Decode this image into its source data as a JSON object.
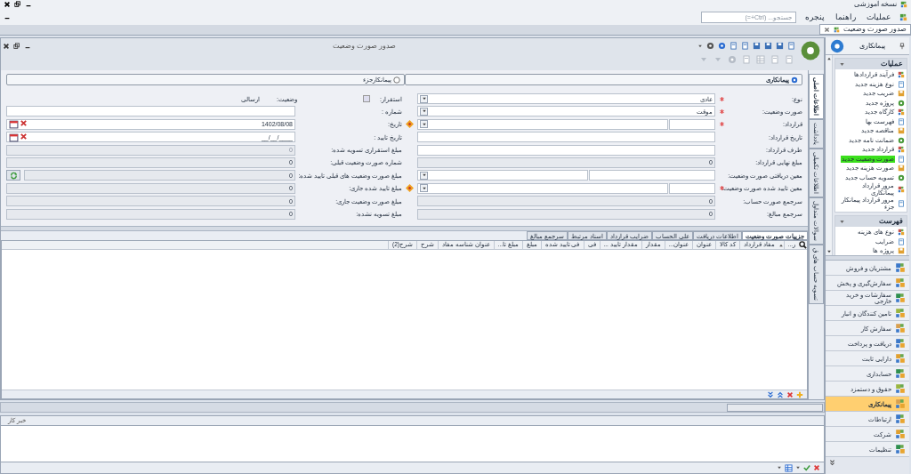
{
  "app_title": "نسخه آموزشی",
  "menu": [
    "عملیات",
    "راهنما",
    "پنجره"
  ],
  "search": {
    "placeholder": "جستجو... (Ctrl+=)"
  },
  "document_tabs": [
    {
      "label": "صدور صورت وضعیت",
      "selected": true
    }
  ],
  "window": {
    "title": "صدور صورت وضعیت"
  },
  "contractor_type": [
    {
      "label": "پیمانکاری",
      "selected": true
    },
    {
      "label": "پیمانکارجزء",
      "selected": false
    }
  ],
  "side_tabs": [
    {
      "label": "اطلاعات اصلی",
      "selected": true
    },
    {
      "label": "یادداشت",
      "selected": false
    },
    {
      "label": "اطلاعات تکمیلی",
      "selected": false
    },
    {
      "label": "سوالات متداول",
      "selected": false
    },
    {
      "label": "تسویه حساب های ق",
      "selected": false
    }
  ],
  "form_right": [
    {
      "label": "نوع:",
      "required": true,
      "kind": "select",
      "value": "عادی"
    },
    {
      "label": "صورت وضعیت:",
      "required": true,
      "kind": "select",
      "value": "موقت"
    },
    {
      "label": "قرارداد:",
      "required": true,
      "kind": "split_select"
    },
    {
      "label": "تاریخ قرارداد:",
      "required": false,
      "kind": "text"
    },
    {
      "label": "طرف قرارداد:",
      "required": false,
      "kind": "text"
    },
    {
      "label": "مبلغ نهایی قرارداد:",
      "required": false,
      "kind": "readonly",
      "value": "0"
    },
    {
      "label": "معین دریافتی صورت وضعیت:",
      "required": false,
      "kind": "split_select_wide"
    },
    {
      "label": "معین تایید شده صورت وضعیت:",
      "required": true,
      "kind": "split_select"
    },
    {
      "label": "سرجمع صورت حساب:",
      "required": false,
      "kind": "readonly",
      "value": "0"
    },
    {
      "label": "سرجمع مبالغ:",
      "required": false,
      "kind": "readonly",
      "value": "0"
    }
  ],
  "settlement": {
    "label": "استقرار:",
    "checked": false
  },
  "status": {
    "label": "وضعیت:",
    "value": "ارسالی"
  },
  "form_left": [
    {
      "label": "شماره :",
      "flag": false,
      "kind": "text"
    },
    {
      "label": "تاریخ:",
      "flag": true,
      "kind": "date",
      "value": "1402/08/08"
    },
    {
      "label": "تاریخ تایید :",
      "flag": false,
      "kind": "date",
      "value": "____/__/__"
    },
    {
      "label": "مبلغ استقراری تسویه شده:",
      "flag": false,
      "kind": "disabled",
      "value": "0"
    },
    {
      "label": "شماره صورت وضعیت قبلی:",
      "flag": false,
      "kind": "readonly",
      "value": "0"
    },
    {
      "label": "مبلغ صورت وضعیت های قبلی تایید شده:",
      "flag": false,
      "kind": "refresh",
      "value": "0"
    },
    {
      "label": "مبلغ  تایید شده جاری:",
      "flag": true,
      "kind": "readonly",
      "value": "0"
    },
    {
      "label": "مبلغ صورت وضعیت جاری:",
      "flag": false,
      "kind": "readonly",
      "value": "0"
    },
    {
      "label": "مبلغ تسویه نشده:",
      "flag": false,
      "kind": "readonly",
      "value": "0"
    }
  ],
  "grid_tabs": [
    {
      "label": "جزییات صورت وضعیت",
      "selected": true
    },
    {
      "label": "اطلاعات دریافت",
      "selected": false
    },
    {
      "label": "علی الحساب",
      "selected": false
    },
    {
      "label": "ضرایب قرارداد",
      "selected": false
    },
    {
      "label": "اسناد مرتبط",
      "selected": false
    },
    {
      "label": "سرجمع مبالغ",
      "selected": false
    }
  ],
  "grid_columns": [
    "ر...",
    "مفاد قرارداد",
    "کد کالا",
    "عنوان",
    "عنوان...",
    "مقدار",
    "مقدار تایید ...",
    "فی",
    "فی تایید شده",
    "مبلغ",
    "مبلغ تا...",
    "عنوان شناسه مفاد",
    "شرح",
    "شرح(2)"
  ],
  "bottom_panel": {
    "title": "خبر کار"
  },
  "sidebar": {
    "title": "پیمانکاری",
    "sections": [
      {
        "title": "عملیات",
        "items": [
          {
            "label": "فرآیند قراردادها",
            "selected": false
          },
          {
            "label": "نوع هزینه جدید",
            "selected": false
          },
          {
            "label": "ضریب جدید",
            "selected": false
          },
          {
            "label": "پروژه جدید",
            "selected": false
          },
          {
            "label": "کارگاه جدید",
            "selected": false
          },
          {
            "label": "فهرست بها",
            "selected": false
          },
          {
            "label": "مناقصه جدید",
            "selected": false
          },
          {
            "label": "ضمانت نامه جدید",
            "selected": false
          },
          {
            "label": "قرارداد جدید",
            "selected": false
          },
          {
            "label": "صورت وضعیت جدید",
            "selected": true
          },
          {
            "label": "صورت هزینه جدید",
            "selected": false
          },
          {
            "label": "تسویه حساب جدید",
            "selected": false
          },
          {
            "label": "مرور قرارداد پیمانکاری",
            "selected": false
          },
          {
            "label": "مرور قرارداد پیمانکار جزء",
            "selected": false
          }
        ]
      },
      {
        "title": "فهرست",
        "items": [
          {
            "label": "نوع های هزینه",
            "selected": false
          },
          {
            "label": "ضرایب",
            "selected": false
          },
          {
            "label": "پروژه ها",
            "selected": false
          }
        ]
      }
    ]
  },
  "modules": [
    {
      "label": "مشتریان و فروش",
      "selected": false
    },
    {
      "label": "سفارش‌گیری و پخش",
      "selected": false
    },
    {
      "label": "سفارشات و خرید خارجی",
      "selected": false
    },
    {
      "label": "تامین کنندگان و انبار",
      "selected": false
    },
    {
      "label": "سفارش کار",
      "selected": false
    },
    {
      "label": "دریافت و پرداخت",
      "selected": false
    },
    {
      "label": "دارایی ثابت",
      "selected": false
    },
    {
      "label": "حسابداری",
      "selected": false
    },
    {
      "label": "حقوق و دستمزد",
      "selected": false
    },
    {
      "label": "پیمانکاری",
      "selected": true
    },
    {
      "label": "ارتباطات",
      "selected": false
    },
    {
      "label": "شرکت",
      "selected": false
    },
    {
      "label": "تنظیمات",
      "selected": false
    }
  ]
}
